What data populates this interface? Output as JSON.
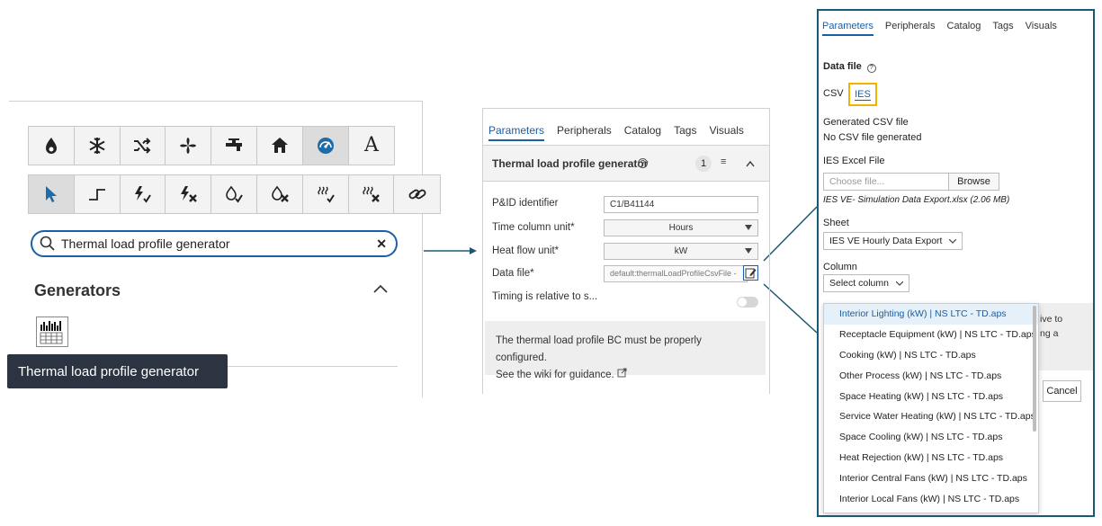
{
  "library": {
    "toolbar_row1": [
      {
        "icon": "flame-icon"
      },
      {
        "icon": "snowflake-icon"
      },
      {
        "icon": "shuffle-icon"
      },
      {
        "icon": "fan-icon"
      },
      {
        "icon": "faucet-icon"
      },
      {
        "icon": "home-icon"
      },
      {
        "icon": "gauge-icon",
        "active": true
      },
      {
        "icon": "letter-a-icon",
        "glyph": "A"
      }
    ],
    "toolbar_row2": [
      {
        "icon": "pointer-icon",
        "active": true
      },
      {
        "icon": "step-line-icon"
      },
      {
        "icon": "power-check-icon"
      },
      {
        "icon": "power-x-icon"
      },
      {
        "icon": "flame-check-icon"
      },
      {
        "icon": "flame-x-icon"
      },
      {
        "icon": "heat-check-icon"
      },
      {
        "icon": "heat-x-icon"
      },
      {
        "icon": "link-icon"
      }
    ],
    "search_value": "Thermal load profile generator",
    "clear_glyph": "✕",
    "generators_title": "Generators",
    "tooltip": "Thermal load profile generator"
  },
  "params": {
    "tabs": [
      "Parameters",
      "Peripherals",
      "Catalog",
      "Tags",
      "Visuals"
    ],
    "active_tab": "Parameters",
    "section_title": "Thermal load profile generator",
    "section_info": "?",
    "section_badge": "1",
    "section_list_glyph": "≡",
    "rows": {
      "pid_label": "P&ID identifier",
      "pid_value": "C1/B41144",
      "time_label": "Time column unit*",
      "time_value": "Hours",
      "heat_label": "Heat flow unit*",
      "heat_value": "kW",
      "file_label": "Data file*",
      "file_value": "default:thermalLoadProfileCsvFile -",
      "timing_label": "Timing is relative to s..."
    },
    "note_line1": "The thermal load profile BC must be properly configured.",
    "note_line2": "See the wiki for guidance."
  },
  "datafile": {
    "tabs": [
      "Parameters",
      "Peripherals",
      "Catalog",
      "Tags",
      "Visuals"
    ],
    "data_file_label": "Data file",
    "info_glyph": "?",
    "csv_label": "CSV",
    "ies_label": "IES",
    "generated_label": "Generated CSV file",
    "generated_value": "No CSV file generated",
    "excel_label": "IES Excel File",
    "choose_placeholder": "Choose file...",
    "browse_label": "Browse",
    "file_meta": "IES VE- Simulation Data Export.xlsx (2.06 MB)",
    "sheet_label": "Sheet",
    "sheet_value": "IES VE Hourly Data Export",
    "column_label": "Column",
    "column_value": "Select column",
    "options": [
      "Interior Lighting (kW) | NS LTC - TD.aps",
      "Receptacle Equipment (kW) | NS LTC - TD.aps",
      "Cooking (kW) | NS LTC - TD.aps",
      "Other Process (kW) | NS LTC - TD.aps",
      "Space Heating (kW) | NS LTC - TD.aps",
      "Service Water Heating (kW) | NS LTC - TD.aps",
      "Space Cooling (kW) | NS LTC - TD.aps",
      "Heat Rejection (kW) | NS LTC - TD.aps",
      "Interior Central Fans (kW) | NS LTC - TD.aps",
      "Interior Local Fans (kW) | NS LTC - TD.aps"
    ],
    "hidden_text_1": "ive to",
    "hidden_text_2": "ng a",
    "cancel_label": "Cancel"
  }
}
